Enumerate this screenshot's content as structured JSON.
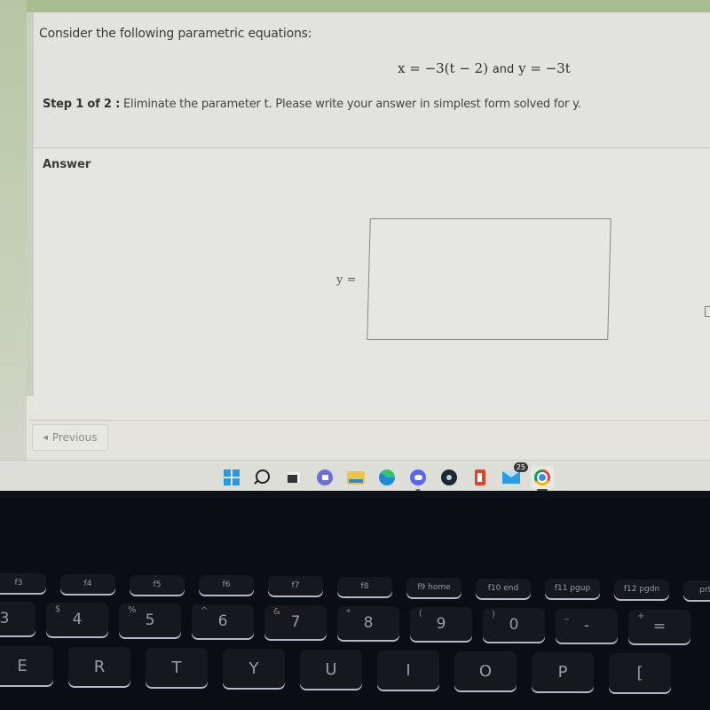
{
  "question": {
    "intro": "Consider the following parametric equations:",
    "equation": {
      "x_expr": "x = −3(t − 2)",
      "conjunction": "and",
      "y_expr": "y = −3t"
    },
    "step_label": "Step 1 of 2 :",
    "step_text": "Eliminate the parameter t. Please write your answer in simplest form solved for y."
  },
  "answer": {
    "heading": "Answer",
    "field_label": "y =",
    "field_value": ""
  },
  "navigation": {
    "previous_label": "Previous"
  },
  "taskbar": {
    "items": [
      {
        "name": "start",
        "label": "Start"
      },
      {
        "name": "search",
        "label": "Search"
      },
      {
        "name": "task-view",
        "label": "Task View"
      },
      {
        "name": "teams-meet",
        "label": "Meet"
      },
      {
        "name": "file-explorer",
        "label": "File Explorer"
      },
      {
        "name": "edge",
        "label": "Microsoft Edge"
      },
      {
        "name": "discord",
        "label": "Discord"
      },
      {
        "name": "steam",
        "label": "Steam"
      },
      {
        "name": "office",
        "label": "Office"
      },
      {
        "name": "mail",
        "label": "Mail",
        "badge": "25"
      },
      {
        "name": "chrome",
        "label": "Google Chrome"
      }
    ],
    "mail_badge": "25"
  },
  "keyboard": {
    "fkeys": [
      "f3",
      "f4",
      "f5",
      "f6",
      "f7",
      "f8",
      "f9 home",
      "f10 end",
      "f11 pgup",
      "f12 pgdn",
      "prt sc"
    ],
    "number_row": [
      {
        "main": "3",
        "sub": "#"
      },
      {
        "main": "4",
        "sub": "$"
      },
      {
        "main": "5",
        "sub": "%"
      },
      {
        "main": "6",
        "sub": "^"
      },
      {
        "main": "7",
        "sub": "&"
      },
      {
        "main": "8",
        "sub": "*"
      },
      {
        "main": "9",
        "sub": "("
      },
      {
        "main": "0",
        "sub": ")"
      },
      {
        "main": "-",
        "sub": "_"
      },
      {
        "main": "=",
        "sub": "+"
      }
    ],
    "letter_row": [
      "E",
      "R",
      "T",
      "Y",
      "U",
      "I",
      "O",
      "P",
      "["
    ]
  }
}
